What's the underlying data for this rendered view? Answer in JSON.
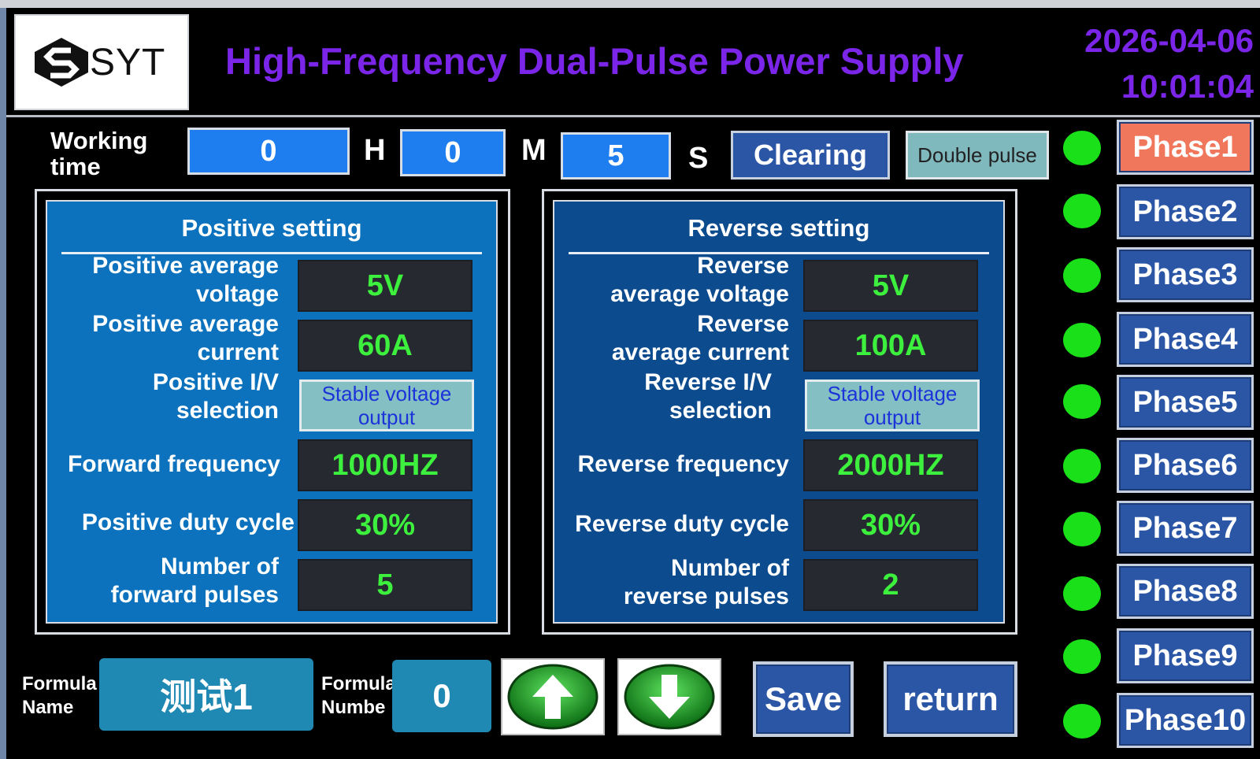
{
  "header": {
    "brand": "SYT",
    "title": "High-Frequency Dual-Pulse Power Supply",
    "date": "2026-04-06",
    "time": "10:01:04"
  },
  "working_time": {
    "label_line1": "Working",
    "label_line2": "time",
    "hours": "0",
    "hours_unit": "H",
    "minutes": "0",
    "minutes_unit": "M",
    "seconds": "5",
    "seconds_unit": "S",
    "clear_label": "Clearing",
    "mode_label": "Double pulse"
  },
  "positive": {
    "title": "Positive setting",
    "voltage_label_1": "Positive average",
    "voltage_label_2": "voltage",
    "voltage": "5V",
    "current_label_1": "Positive average",
    "current_label_2": "current",
    "current": "60A",
    "iv_label_1": "Positive I/V",
    "iv_label_2": "selection",
    "iv_line1": "Stable voltage",
    "iv_line2": "output",
    "freq_label": "Forward frequency",
    "frequency": "1000HZ",
    "duty_label": "Positive duty cycle",
    "duty": "30%",
    "pulses_label_1": "Number of",
    "pulses_label_2": "forward pulses",
    "pulses": "5"
  },
  "reverse": {
    "title": "Reverse setting",
    "voltage_label_1": "Reverse",
    "voltage_label_2": "average voltage",
    "voltage": "5V",
    "current_label_1": "Reverse",
    "current_label_2": "average current",
    "current": "100A",
    "iv_label_1": "Reverse I/V",
    "iv_label_2": "selection",
    "iv_line1": "Stable voltage",
    "iv_line2": "output",
    "freq_label": "Reverse frequency",
    "frequency": "2000HZ",
    "duty_label": "Reverse duty cycle",
    "duty": "30%",
    "pulses_label_1": "Number of",
    "pulses_label_2": "reverse pulses",
    "pulses": "2"
  },
  "phases": [
    {
      "label": "Phase1",
      "active": true
    },
    {
      "label": "Phase2",
      "active": false
    },
    {
      "label": "Phase3",
      "active": false
    },
    {
      "label": "Phase4",
      "active": false
    },
    {
      "label": "Phase5",
      "active": false
    },
    {
      "label": "Phase6",
      "active": false
    },
    {
      "label": "Phase7",
      "active": false
    },
    {
      "label": "Phase8",
      "active": false
    },
    {
      "label": "Phase9",
      "active": false
    },
    {
      "label": "Phase10",
      "active": false
    }
  ],
  "status_lamp_color": "#19e019",
  "formula": {
    "name_label_1": "Formula",
    "name_label_2": "Name",
    "name_value": "测试1",
    "num_label_1": "Formula",
    "num_label_2": "Numbe",
    "num_value": "0"
  },
  "buttons": {
    "up_icon": "arrow-up-icon",
    "down_icon": "arrow-down-icon",
    "save_label": "Save",
    "return_label": "return"
  },
  "colors": {
    "title": "#7a25e8",
    "active_phase": "#f0775c",
    "button": "#2b56a6",
    "value_text": "#3ef03e"
  }
}
